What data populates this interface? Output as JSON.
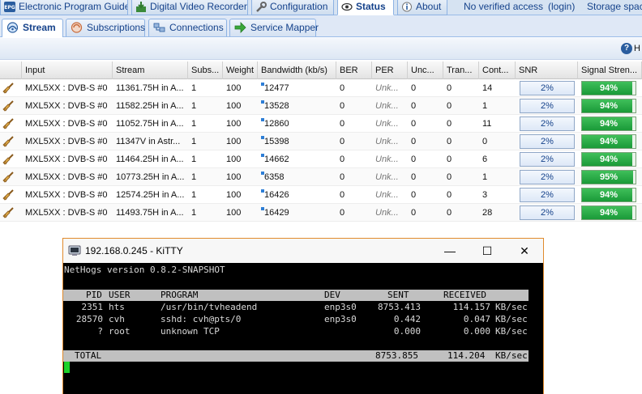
{
  "top_tabs": [
    {
      "label": "Electronic Program Guide",
      "icon": "epg-icon"
    },
    {
      "label": "Digital Video Recorder",
      "icon": "dvr-icon"
    },
    {
      "label": "Configuration",
      "icon": "wrench-icon"
    },
    {
      "label": "Status",
      "icon": "eye-icon",
      "active": true
    },
    {
      "label": "About",
      "icon": "info-icon"
    }
  ],
  "top_info": {
    "access": "No verified access",
    "login": "(login)",
    "storage": "Storage space"
  },
  "sub_tabs": [
    {
      "label": "Stream",
      "icon": "stream-icon",
      "active": true
    },
    {
      "label": "Subscriptions",
      "icon": "subscriptions-icon"
    },
    {
      "label": "Connections",
      "icon": "connections-icon"
    },
    {
      "label": "Service Mapper",
      "icon": "arrow-icon"
    }
  ],
  "toolbar": {
    "help_label": "H"
  },
  "grid": {
    "columns": [
      "Input",
      "Stream",
      "Subs...",
      "Weight",
      "Bandwidth (kb/s)",
      "BER",
      "PER",
      "Unc...",
      "Tran...",
      "Cont...",
      "SNR",
      "Signal Stren..."
    ],
    "rows": [
      {
        "input": "MXL5XX : DVB-S #0",
        "stream": "11361.75H in A...",
        "subs": "1",
        "weight": "100",
        "bandwidth": "12477",
        "ber": "0",
        "per": "Unk...",
        "unc": "0",
        "tran": "0",
        "cont": "14",
        "snr": "2%",
        "signal": "94%"
      },
      {
        "input": "MXL5XX : DVB-S #0",
        "stream": "11582.25H in A...",
        "subs": "1",
        "weight": "100",
        "bandwidth": "13528",
        "ber": "0",
        "per": "Unk...",
        "unc": "0",
        "tran": "0",
        "cont": "1",
        "snr": "2%",
        "signal": "94%"
      },
      {
        "input": "MXL5XX : DVB-S #0",
        "stream": "11052.75H in A...",
        "subs": "1",
        "weight": "100",
        "bandwidth": "12860",
        "ber": "0",
        "per": "Unk...",
        "unc": "0",
        "tran": "0",
        "cont": "11",
        "snr": "2%",
        "signal": "94%"
      },
      {
        "input": "MXL5XX : DVB-S #0",
        "stream": "11347V in Astr...",
        "subs": "1",
        "weight": "100",
        "bandwidth": "15398",
        "ber": "0",
        "per": "Unk...",
        "unc": "0",
        "tran": "0",
        "cont": "0",
        "snr": "2%",
        "signal": "94%"
      },
      {
        "input": "MXL5XX : DVB-S #0",
        "stream": "11464.25H in A...",
        "subs": "1",
        "weight": "100",
        "bandwidth": "14662",
        "ber": "0",
        "per": "Unk...",
        "unc": "0",
        "tran": "0",
        "cont": "6",
        "snr": "2%",
        "signal": "94%"
      },
      {
        "input": "MXL5XX : DVB-S #0",
        "stream": "10773.25H in A...",
        "subs": "1",
        "weight": "100",
        "bandwidth": "6358",
        "ber": "0",
        "per": "Unk...",
        "unc": "0",
        "tran": "0",
        "cont": "1",
        "snr": "2%",
        "signal": "95%"
      },
      {
        "input": "MXL5XX : DVB-S #0",
        "stream": "12574.25H in A...",
        "subs": "1",
        "weight": "100",
        "bandwidth": "16426",
        "ber": "0",
        "per": "Unk...",
        "unc": "0",
        "tran": "0",
        "cont": "3",
        "snr": "2%",
        "signal": "94%"
      },
      {
        "input": "MXL5XX : DVB-S #0",
        "stream": "11493.75H in A...",
        "subs": "1",
        "weight": "100",
        "bandwidth": "16429",
        "ber": "0",
        "per": "Unk...",
        "unc": "0",
        "tran": "0",
        "cont": "28",
        "snr": "2%",
        "signal": "94%"
      }
    ]
  },
  "terminal": {
    "title": "192.168.0.245 - KiTTY",
    "banner": "NetHogs version 0.8.2-SNAPSHOT",
    "header": {
      "pid": "PID",
      "user": "USER",
      "program": "PROGRAM",
      "dev": "DEV",
      "sent": "SENT",
      "received": "RECEIVED"
    },
    "processes": [
      {
        "pid": "2351",
        "user": "hts",
        "program": "/usr/bin/tvheadend",
        "dev": "enp3s0",
        "sent": "8753.413",
        "received": "114.157",
        "unit": "KB/sec"
      },
      {
        "pid": "28570",
        "user": "cvh",
        "program": "sshd: cvh@pts/0",
        "dev": "enp3s0",
        "sent": "0.442",
        "received": "0.047",
        "unit": "KB/sec"
      },
      {
        "pid": "?",
        "user": "root",
        "program": "unknown TCP",
        "dev": "",
        "sent": "0.000",
        "received": "0.000",
        "unit": "KB/sec"
      }
    ],
    "total": {
      "label": "TOTAL",
      "sent": "8753.855",
      "received": "114.204",
      "unit": "KB/sec"
    }
  },
  "colors": {
    "accent": "#15428b",
    "signal_good": "#1a9a38",
    "window_border": "#e08a2c",
    "cursor": "#1ed12a"
  }
}
